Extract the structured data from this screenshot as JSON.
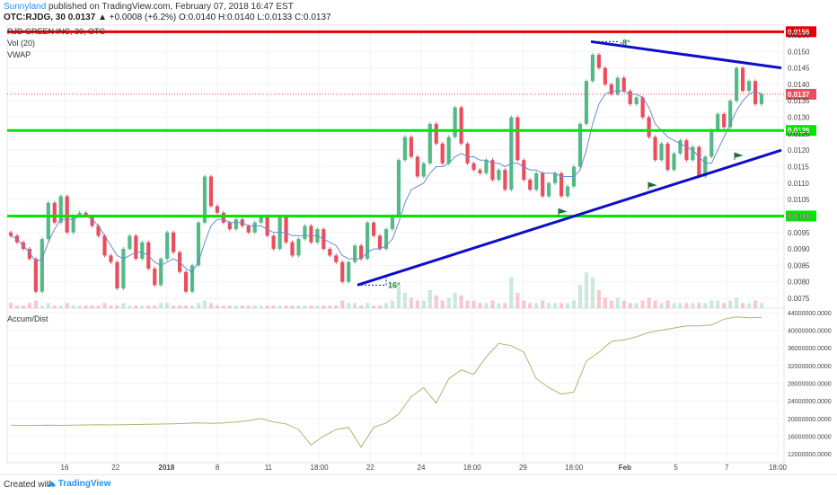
{
  "header": {
    "author": "Sunnyland",
    "published": "published on TradingView.com, February 07, 2018 16:47 EST",
    "symbol_line": "OTC:RJDG, 30",
    "price": "0.0137",
    "change": "▲ +0.0008 (+6.2%)",
    "ohlc": "O:0.0140 H:0.0140 L:0.0133 C:0.0137"
  },
  "studies": {
    "name": "RJD GREEN INC, 30, OTC",
    "vol": "Vol (20)",
    "vwap": "VWAP",
    "accum": "Accum/Dist"
  },
  "footer": {
    "created": "Created with",
    "brand": "TradingView"
  },
  "colors": {
    "up": "#53b987",
    "down": "#eb4d5c",
    "green_line": "#00e600",
    "red_line": "#e60000",
    "trend_line": "#0d0dcc",
    "vwap": "#6a8ad0",
    "accum": "#b3b36a",
    "price_badge": "#eb4d5c"
  },
  "chart_data": [
    {
      "type": "candlestick",
      "title": "RJD GREEN INC, 30, OTC",
      "ylim": [
        0.0072,
        0.0158
      ],
      "y_ticks": [
        "0.0155",
        "0.0150",
        "0.0145",
        "0.0140",
        "0.0135",
        "0.0130",
        "0.0125",
        "0.0120",
        "0.0115",
        "0.0110",
        "0.0105",
        "0.0100",
        "0.0095",
        "0.0090",
        "0.0085",
        "0.0080",
        "0.0075"
      ],
      "x_ticks": [
        "16",
        "22",
        "2018",
        "8",
        "11",
        "18:00",
        "22",
        "24",
        "18:00",
        "29",
        "18:00",
        "Feb",
        "5",
        "7",
        "18:00"
      ],
      "levels": [
        {
          "value": 0.0156,
          "label": "0.0156",
          "color": "red"
        },
        {
          "value": 0.0126,
          "label": "0.0126",
          "color": "green"
        },
        {
          "value": 0.01,
          "label": "0.0100",
          "color": "green"
        }
      ],
      "current_price": {
        "value": 0.0137,
        "label": "0.0137"
      },
      "annotations": [
        {
          "text": "-8°"
        },
        {
          "text": "16°"
        }
      ],
      "candles": [
        [
          0.0095,
          0.0094
        ],
        [
          0.0094,
          0.0092
        ],
        [
          0.0092,
          0.009
        ],
        [
          0.009,
          0.0087
        ],
        [
          0.0087,
          0.0077
        ],
        [
          0.0077,
          0.0093
        ],
        [
          0.0093,
          0.0104
        ],
        [
          0.0104,
          0.0098
        ],
        [
          0.0098,
          0.0106
        ],
        [
          0.0106,
          0.0095
        ],
        [
          0.0095,
          0.01
        ],
        [
          0.01,
          0.0101
        ],
        [
          0.0101,
          0.01
        ],
        [
          0.01,
          0.0097
        ],
        [
          0.0097,
          0.0094
        ],
        [
          0.0094,
          0.0088
        ],
        [
          0.0088,
          0.0086
        ],
        [
          0.0086,
          0.0078
        ],
        [
          0.0078,
          0.009
        ],
        [
          0.009,
          0.0094
        ],
        [
          0.0094,
          0.0087
        ],
        [
          0.0087,
          0.0092
        ],
        [
          0.0092,
          0.0084
        ],
        [
          0.0084,
          0.0079
        ],
        [
          0.0079,
          0.0087
        ],
        [
          0.0087,
          0.0095
        ],
        [
          0.0095,
          0.0089
        ],
        [
          0.0089,
          0.0083
        ],
        [
          0.0083,
          0.0077
        ],
        [
          0.0077,
          0.0085
        ],
        [
          0.0085,
          0.0098
        ],
        [
          0.0098,
          0.0112
        ],
        [
          0.0112,
          0.0103
        ],
        [
          0.0103,
          0.0101
        ],
        [
          0.0101,
          0.0098
        ],
        [
          0.0098,
          0.0096
        ],
        [
          0.0096,
          0.0099
        ],
        [
          0.0099,
          0.0097
        ],
        [
          0.0097,
          0.0095
        ],
        [
          0.0095,
          0.0098
        ],
        [
          0.0098,
          0.01
        ],
        [
          0.01,
          0.0094
        ],
        [
          0.0094,
          0.009
        ],
        [
          0.009,
          0.01
        ],
        [
          0.01,
          0.0092
        ],
        [
          0.0092,
          0.0088
        ],
        [
          0.0088,
          0.0093
        ],
        [
          0.0093,
          0.0097
        ],
        [
          0.0097,
          0.0092
        ],
        [
          0.0092,
          0.0096
        ],
        [
          0.0096,
          0.009
        ],
        [
          0.009,
          0.0088
        ],
        [
          0.0088,
          0.0086
        ],
        [
          0.0086,
          0.008
        ],
        [
          0.008,
          0.0086
        ],
        [
          0.0086,
          0.0091
        ],
        [
          0.0091,
          0.0087
        ],
        [
          0.0087,
          0.0098
        ],
        [
          0.0098,
          0.0094
        ],
        [
          0.0094,
          0.009
        ],
        [
          0.009,
          0.0096
        ],
        [
          0.0096,
          0.01
        ],
        [
          0.01,
          0.0117
        ],
        [
          0.0117,
          0.0124
        ],
        [
          0.0124,
          0.0118
        ],
        [
          0.0118,
          0.0112
        ],
        [
          0.0112,
          0.0116
        ],
        [
          0.0116,
          0.0128
        ],
        [
          0.0128,
          0.0122
        ],
        [
          0.0122,
          0.0116
        ],
        [
          0.0116,
          0.0124
        ],
        [
          0.0124,
          0.0133
        ],
        [
          0.0133,
          0.0122
        ],
        [
          0.0122,
          0.0116
        ],
        [
          0.0116,
          0.0114
        ],
        [
          0.0114,
          0.0113
        ],
        [
          0.0113,
          0.0117
        ],
        [
          0.0117,
          0.0111
        ],
        [
          0.0111,
          0.0114
        ],
        [
          0.0114,
          0.0108
        ],
        [
          0.0108,
          0.013
        ],
        [
          0.013,
          0.0117
        ],
        [
          0.0117,
          0.0111
        ],
        [
          0.0111,
          0.0108
        ],
        [
          0.0108,
          0.0113
        ],
        [
          0.0113,
          0.0106
        ],
        [
          0.0106,
          0.011
        ],
        [
          0.011,
          0.0113
        ],
        [
          0.0113,
          0.0106
        ],
        [
          0.0106,
          0.0109
        ],
        [
          0.0109,
          0.0115
        ],
        [
          0.0115,
          0.0128
        ],
        [
          0.0128,
          0.0141
        ],
        [
          0.0141,
          0.0149
        ],
        [
          0.0149,
          0.0145
        ],
        [
          0.0145,
          0.014
        ],
        [
          0.014,
          0.0137
        ],
        [
          0.0137,
          0.0142
        ],
        [
          0.0142,
          0.0138
        ],
        [
          0.0138,
          0.0134
        ],
        [
          0.0134,
          0.0136
        ],
        [
          0.0136,
          0.013
        ],
        [
          0.013,
          0.0124
        ],
        [
          0.0124,
          0.0117
        ],
        [
          0.0117,
          0.0122
        ],
        [
          0.0122,
          0.0114
        ],
        [
          0.0114,
          0.0119
        ],
        [
          0.0119,
          0.0123
        ],
        [
          0.0123,
          0.0117
        ],
        [
          0.0117,
          0.0121
        ],
        [
          0.0121,
          0.0112
        ],
        [
          0.0112,
          0.0118
        ],
        [
          0.0118,
          0.0126
        ],
        [
          0.0126,
          0.0131
        ],
        [
          0.0131,
          0.0127
        ],
        [
          0.0127,
          0.0135
        ],
        [
          0.0135,
          0.0145
        ],
        [
          0.0145,
          0.0138
        ],
        [
          0.0138,
          0.0141
        ],
        [
          0.0141,
          0.0134
        ],
        [
          0.0134,
          0.0137
        ]
      ],
      "volume": [
        2,
        1,
        1,
        2,
        3,
        1,
        2,
        1,
        1,
        2,
        1,
        1,
        1,
        1,
        1,
        2,
        1,
        1,
        2,
        1,
        1,
        1,
        1,
        1,
        2,
        2,
        1,
        1,
        1,
        1,
        2,
        3,
        2,
        1,
        1,
        1,
        1,
        1,
        1,
        1,
        1,
        1,
        1,
        1,
        1,
        1,
        1,
        1,
        1,
        1,
        1,
        1,
        1,
        3,
        2,
        2,
        1,
        2,
        1,
        1,
        2,
        3,
        9,
        6,
        4,
        3,
        3,
        7,
        5,
        3,
        4,
        6,
        5,
        3,
        3,
        2,
        2,
        3,
        2,
        2,
        12,
        6,
        3,
        2,
        2,
        3,
        2,
        2,
        2,
        2,
        3,
        9,
        14,
        12,
        7,
        4,
        3,
        4,
        3,
        2,
        2,
        3,
        4,
        3,
        2,
        3,
        2,
        2,
        2,
        2,
        2,
        2,
        3,
        3,
        2,
        3,
        4,
        2,
        2,
        3,
        2
      ],
      "vwap": [
        0.0094,
        0.0093,
        0.0091,
        0.0089,
        0.0086,
        0.0087,
        0.0092,
        0.0096,
        0.0099,
        0.0099,
        0.0099,
        0.01,
        0.01,
        0.0099,
        0.0097,
        0.0094,
        0.0091,
        0.0088,
        0.0087,
        0.0088,
        0.0089,
        0.0089,
        0.0088,
        0.0086,
        0.0085,
        0.0086,
        0.0087,
        0.0086,
        0.0084,
        0.0083,
        0.0086,
        0.0092,
        0.0097,
        0.0099,
        0.0099,
        0.0098,
        0.0098,
        0.0098,
        0.0097,
        0.0097,
        0.0097,
        0.0096,
        0.0095,
        0.0095,
        0.0095,
        0.0094,
        0.0094,
        0.0094,
        0.0094,
        0.0094,
        0.0093,
        0.0092,
        0.0091,
        0.0088,
        0.0087,
        0.0087,
        0.0087,
        0.0089,
        0.009,
        0.009,
        0.0091,
        0.0093,
        0.0098,
        0.0104,
        0.0108,
        0.0109,
        0.011,
        0.0113,
        0.0115,
        0.0115,
        0.0116,
        0.0118,
        0.0119,
        0.0118,
        0.0118,
        0.0117,
        0.0117,
        0.0116,
        0.0116,
        0.0115,
        0.0116,
        0.0116,
        0.0115,
        0.0114,
        0.0114,
        0.0113,
        0.0113,
        0.0113,
        0.0112,
        0.0112,
        0.0112,
        0.0114,
        0.012,
        0.0128,
        0.0134,
        0.0137,
        0.0138,
        0.0138,
        0.0138,
        0.0137,
        0.0137,
        0.0136,
        0.0133,
        0.0128,
        0.0126,
        0.0124,
        0.0123,
        0.0122,
        0.0121,
        0.012,
        0.0118,
        0.0116,
        0.0116,
        0.012,
        0.0124,
        0.0128,
        0.0132,
        0.0135,
        0.0137,
        0.0138,
        0.0137
      ]
    },
    {
      "type": "line",
      "title": "Accum/Dist",
      "ylim": [
        10000000,
        45000000
      ],
      "y_ticks": [
        "44000000.0000",
        "40000000.0000",
        "36000000.0000",
        "32000000.0000",
        "28000000.0000",
        "24000000.0000",
        "20000000.0000",
        "16000000.0000",
        "12000000.0000"
      ],
      "values": [
        18500000,
        18400000,
        18450000,
        18500000,
        18450000,
        18500000,
        18550000,
        18600000,
        18550000,
        18600000,
        18650000,
        18700000,
        18750000,
        18800000,
        18900000,
        19000000,
        18900000,
        19000000,
        19200000,
        19500000,
        20000000,
        19200000,
        18800000,
        17500000,
        14000000,
        16000000,
        17500000,
        18000000,
        13500000,
        18000000,
        19000000,
        21000000,
        25000000,
        27000000,
        23500000,
        29000000,
        31000000,
        30000000,
        34000000,
        37000000,
        36500000,
        35000000,
        29000000,
        27000000,
        25500000,
        26000000,
        33000000,
        35000000,
        37500000,
        37800000,
        38500000,
        39500000,
        40000000,
        40500000,
        41000000,
        41000000,
        41200000,
        42500000,
        43000000,
        42800000,
        42900000
      ]
    }
  ]
}
